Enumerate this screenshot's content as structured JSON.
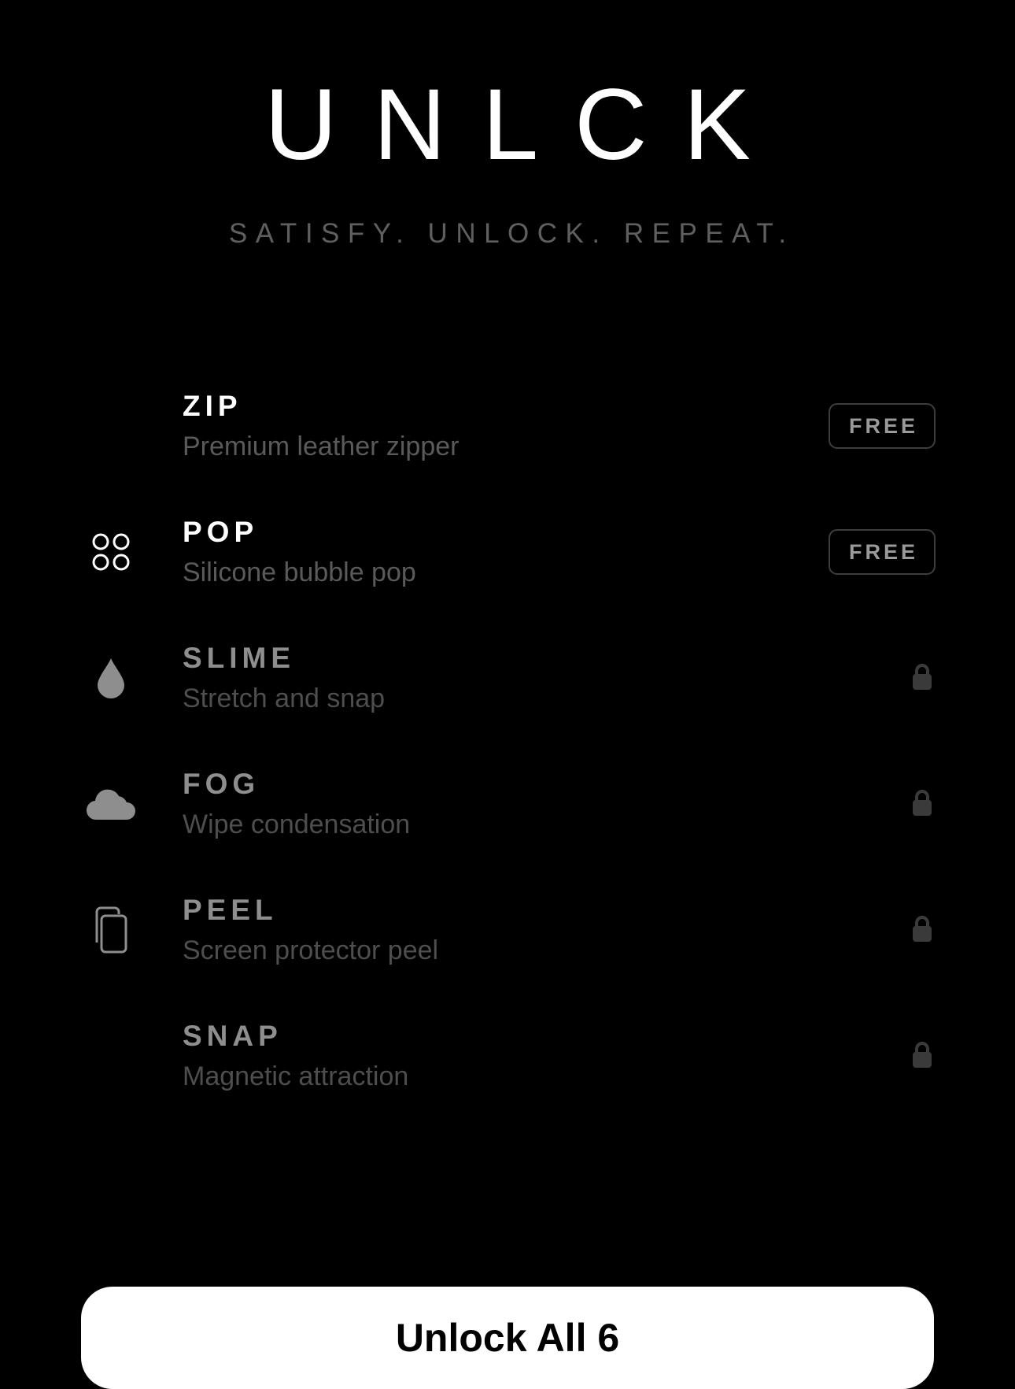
{
  "header": {
    "title": "UNLCK",
    "tagline": "SATISFY. UNLOCK. REPEAT."
  },
  "experiences": [
    {
      "name": "ZIP",
      "description": "Premium leather zipper",
      "icon": "none",
      "status": "free",
      "badge_label": "FREE"
    },
    {
      "name": "POP",
      "description": "Silicone bubble pop",
      "icon": "four-circles-icon",
      "status": "free",
      "badge_label": "FREE"
    },
    {
      "name": "SLIME",
      "description": "Stretch and snap",
      "icon": "drop-icon",
      "status": "locked"
    },
    {
      "name": "FOG",
      "description": "Wipe condensation",
      "icon": "cloud-icon",
      "status": "locked"
    },
    {
      "name": "PEEL",
      "description": "Screen protector peel",
      "icon": "stacked-pages-icon",
      "status": "locked"
    },
    {
      "name": "SNAP",
      "description": "Magnetic attraction",
      "icon": "none",
      "status": "locked"
    }
  ],
  "cta": {
    "label": "Unlock All 6"
  },
  "colors": {
    "background": "#000000",
    "title": "#ffffff",
    "tagline": "#5f5f5f",
    "unlocked_name": "#ffffff",
    "locked_name": "#8e8e8e",
    "badge_border": "#3d3d3d",
    "lock": "#3a3a3a",
    "cta_background": "#ffffff",
    "cta_text": "#000000"
  }
}
